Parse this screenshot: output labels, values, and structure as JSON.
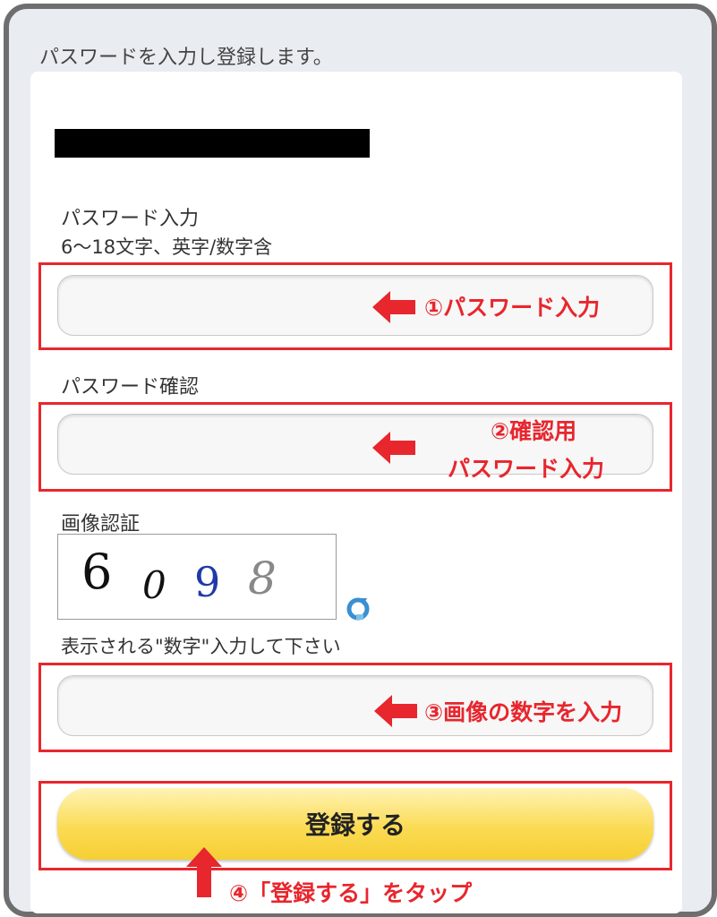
{
  "header": {
    "text": "パスワードを入力し登録します。"
  },
  "password": {
    "label": "パスワード入力",
    "hint": "6～18文字、英字/数字含",
    "value": "",
    "annotation": "①パスワード入力"
  },
  "confirm": {
    "label": "パスワード確認",
    "value": "",
    "annotation_line1": "②確認用",
    "annotation_line2": "パスワード入力"
  },
  "captcha": {
    "label": "画像認証",
    "digits": [
      "6",
      "0",
      "9",
      "8"
    ],
    "refresh_icon": "refresh-icon",
    "hint": "表示される\"数字\"入力して下さい",
    "value": "",
    "annotation": "③画像の数字を入力"
  },
  "submit": {
    "label": "登録する",
    "annotation": "④「登録する」をタップ"
  },
  "colors": {
    "annotation_red": "#e8262d",
    "button_yellow": "#fbdb55",
    "frame_gray": "#6e6e6e"
  }
}
